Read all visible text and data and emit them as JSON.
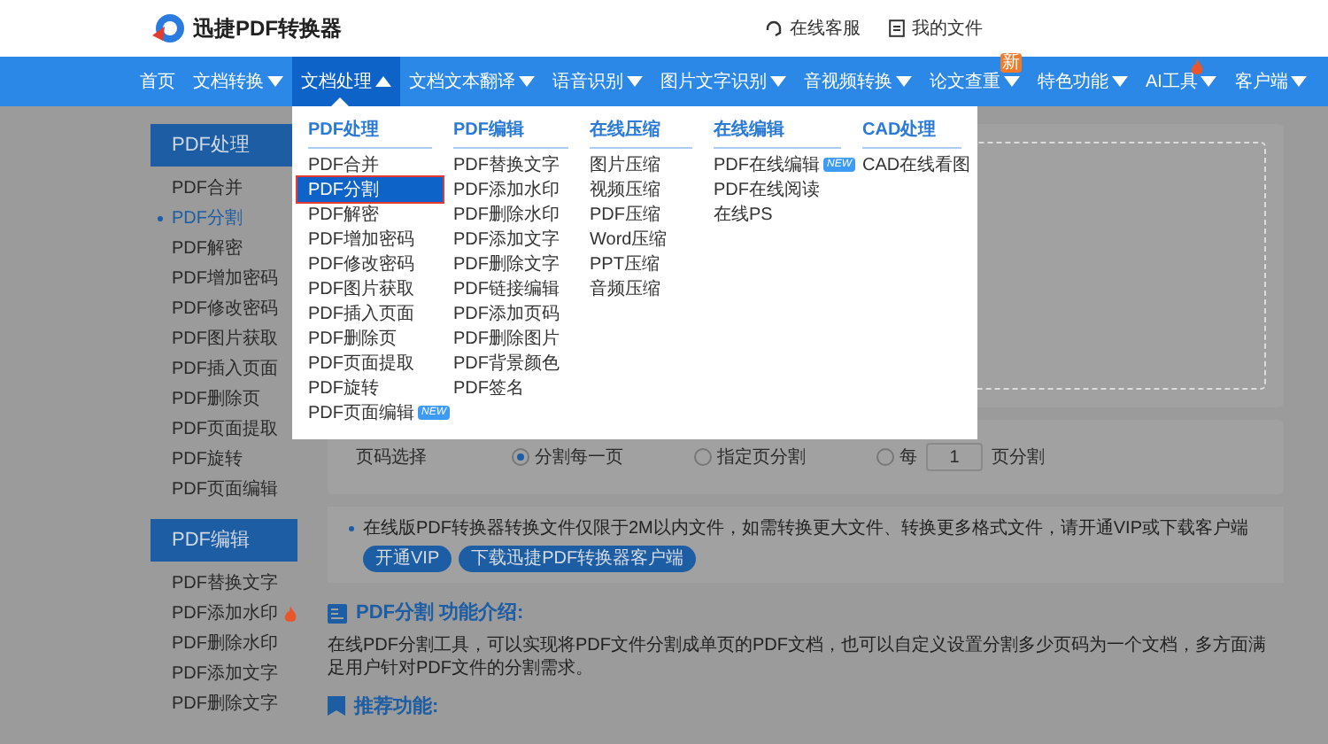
{
  "header": {
    "logo_text": "迅捷PDF转换器",
    "links": [
      {
        "kind": "service",
        "label": "在线客服"
      },
      {
        "kind": "files",
        "label": "我的文件"
      }
    ]
  },
  "nav": [
    {
      "label": "首页",
      "selected": false,
      "caret": false
    },
    {
      "label": "文档转换",
      "selected": false,
      "caret": true
    },
    {
      "label": "文档处理",
      "selected": true,
      "caret": true
    },
    {
      "label": "文档文本翻译",
      "selected": false,
      "caret": true
    },
    {
      "label": "语音识别",
      "selected": false,
      "caret": true
    },
    {
      "label": "图片文字识别",
      "selected": false,
      "caret": true
    },
    {
      "label": "音视频转换",
      "selected": false,
      "caret": true
    },
    {
      "label": "论文查重",
      "selected": false,
      "caret": true,
      "badge": "新"
    },
    {
      "label": "特色功能",
      "selected": false,
      "caret": true
    },
    {
      "label": "AI工具",
      "selected": false,
      "caret": true,
      "hot": true
    },
    {
      "label": "客户端",
      "selected": false,
      "caret": true
    }
  ],
  "dropdown": [
    {
      "title": "PDF处理",
      "items": [
        {
          "label": "PDF合并",
          "selected": false
        },
        {
          "label": "PDF分割",
          "selected": true,
          "annotated": true
        },
        {
          "label": "PDF解密",
          "selected": false
        },
        {
          "label": "PDF增加密码",
          "selected": false
        },
        {
          "label": "PDF修改密码",
          "selected": false
        },
        {
          "label": "PDF图片获取",
          "selected": false
        },
        {
          "label": "PDF插入页面",
          "selected": false
        },
        {
          "label": "PDF删除页",
          "selected": false
        },
        {
          "label": "PDF页面提取",
          "selected": false
        },
        {
          "label": "PDF旋转",
          "selected": false
        },
        {
          "label": "PDF页面编辑",
          "selected": false,
          "badge": "NEW"
        }
      ]
    },
    {
      "title": "PDF编辑",
      "items": [
        {
          "label": "PDF替换文字",
          "selected": false
        },
        {
          "label": "PDF添加水印",
          "selected": false
        },
        {
          "label": "PDF删除水印",
          "selected": false
        },
        {
          "label": "PDF添加文字",
          "selected": false
        },
        {
          "label": "PDF删除文字",
          "selected": false
        },
        {
          "label": "PDF链接编辑",
          "selected": false
        },
        {
          "label": "PDF添加页码",
          "selected": false
        },
        {
          "label": "PDF删除图片",
          "selected": false
        },
        {
          "label": "PDF背景颜色",
          "selected": false
        },
        {
          "label": "PDF签名",
          "selected": false
        }
      ]
    },
    {
      "title": "在线压缩",
      "items": [
        {
          "label": "图片压缩",
          "selected": false
        },
        {
          "label": "视频压缩",
          "selected": false
        },
        {
          "label": "PDF压缩",
          "selected": false
        },
        {
          "label": "Word压缩",
          "selected": false
        },
        {
          "label": "PPT压缩",
          "selected": false
        },
        {
          "label": "音频压缩",
          "selected": false
        }
      ]
    },
    {
      "title": "在线编辑",
      "items": [
        {
          "label": "PDF在线编辑",
          "selected": false,
          "badge": "NEW"
        },
        {
          "label": "PDF在线阅读",
          "selected": false
        },
        {
          "label": "在线PS",
          "selected": false
        }
      ]
    },
    {
      "title": "CAD处理",
      "items": [
        {
          "label": "CAD在线看图",
          "selected": false
        }
      ]
    }
  ],
  "sidebar": [
    {
      "title": "PDF处理",
      "items": [
        {
          "label": "PDF合并",
          "selected": false
        },
        {
          "label": "PDF分割",
          "selected": true
        },
        {
          "label": "PDF解密",
          "selected": false
        },
        {
          "label": "PDF增加密码",
          "selected": false
        },
        {
          "label": "PDF修改密码",
          "selected": false
        },
        {
          "label": "PDF图片获取",
          "selected": false
        },
        {
          "label": "PDF插入页面",
          "selected": false
        },
        {
          "label": "PDF删除页",
          "selected": false
        },
        {
          "label": "PDF页面提取",
          "selected": false
        },
        {
          "label": "PDF旋转",
          "selected": false
        },
        {
          "label": "PDF页面编辑",
          "selected": false
        }
      ]
    },
    {
      "title": "PDF编辑",
      "items": [
        {
          "label": "PDF替换文字",
          "selected": false
        },
        {
          "label": "PDF添加水印",
          "selected": false,
          "hot": true
        },
        {
          "label": "PDF删除水印",
          "selected": false
        },
        {
          "label": "PDF添加文字",
          "selected": false
        },
        {
          "label": "PDF删除文字",
          "selected": false
        }
      ]
    }
  ],
  "options": {
    "label": "页码选择",
    "choices": [
      {
        "kind": "plain",
        "label": "分割每一页",
        "selected": true
      },
      {
        "kind": "plain",
        "label": "指定页分割",
        "selected": false
      },
      {
        "kind": "every",
        "prefix": "每",
        "value": "1",
        "suffix": "页分割",
        "selected": false
      }
    ]
  },
  "notice": {
    "text": "在线版PDF转换器转换文件仅限于2M以内文件，如需转换更大文件、转换更多格式文件，请开通VIP或下载客户端",
    "buttons": [
      "开通VIP",
      "下载迅捷PDF转换器客户端"
    ]
  },
  "intro": {
    "title": "PDF分割 功能介绍:",
    "body": "在线PDF分割工具，可以实现将PDF文件分割成单页的PDF文档，也可以自定义设置分割多少页码为一个文档，多方面满足用户针对PDF文件的分割需求。"
  },
  "recommend": {
    "title": "推荐功能:"
  }
}
